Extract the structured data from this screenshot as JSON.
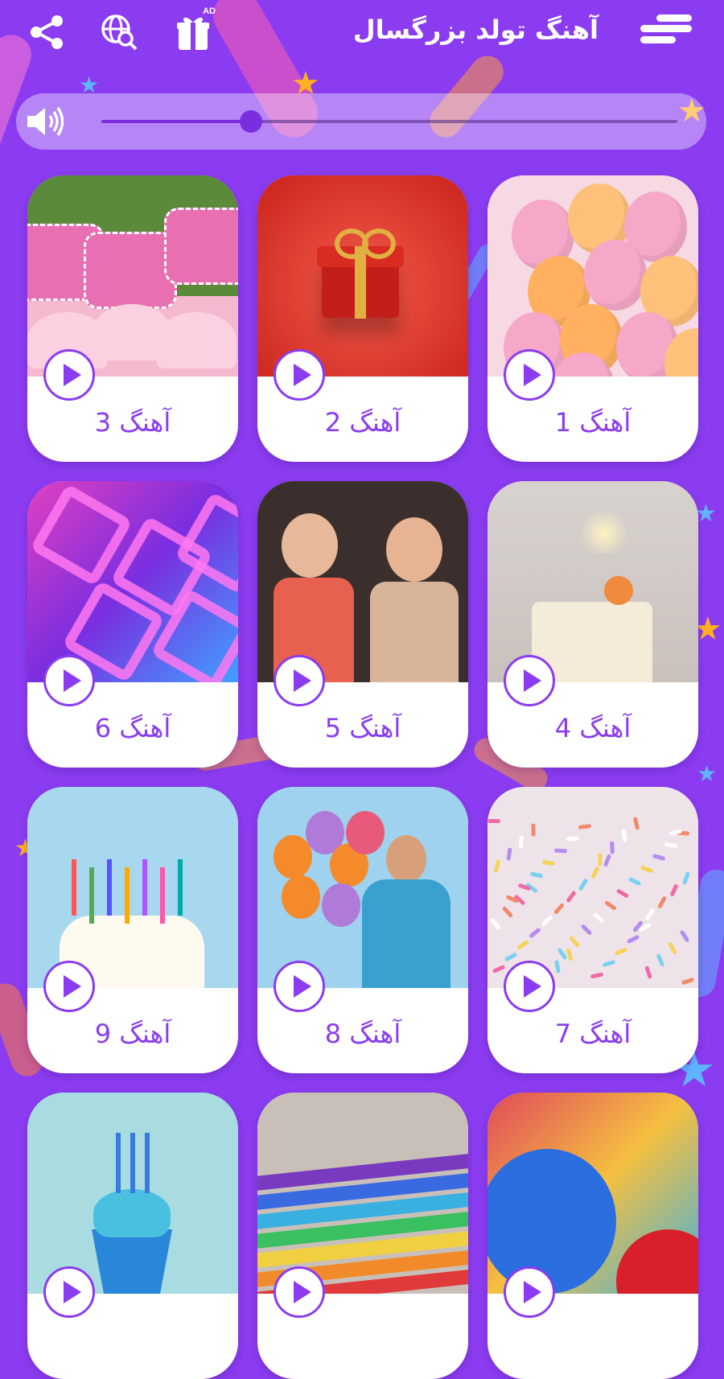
{
  "header": {
    "title": "آهنگ تولد بزرگسال",
    "ad_badge": "AD",
    "icons": [
      "menu-icon",
      "gift-icon",
      "globe-search-icon",
      "share-icon"
    ]
  },
  "volume": {
    "level": 0.26,
    "icon": "speaker-icon"
  },
  "colors": {
    "background": "#8b3cf0",
    "accent": "#8b3cf0",
    "card": "#ffffff"
  },
  "songs": [
    {
      "label": "آهنگ 1",
      "image": "pink-orange-balloons"
    },
    {
      "label": "آهنگ 2",
      "image": "red-gift-box"
    },
    {
      "label": "آهنگ 3",
      "image": "pink-birthday-cupcakes"
    },
    {
      "label": "آهنگ 4",
      "image": "cake-with-sparkler"
    },
    {
      "label": "آهنگ 5",
      "image": "women-celebrating"
    },
    {
      "label": "آهنگ 6",
      "image": "purple-ribbons"
    },
    {
      "label": "آهنگ 7",
      "image": "colorful-sprinkles"
    },
    {
      "label": "آهنگ 8",
      "image": "man-with-balloons"
    },
    {
      "label": "آهنگ 9",
      "image": "birthday-candle-cake"
    },
    {
      "label": "",
      "image": "foil-balloons"
    },
    {
      "label": "",
      "image": "rainbow-cake"
    },
    {
      "label": "",
      "image": "blue-cupcake"
    }
  ]
}
